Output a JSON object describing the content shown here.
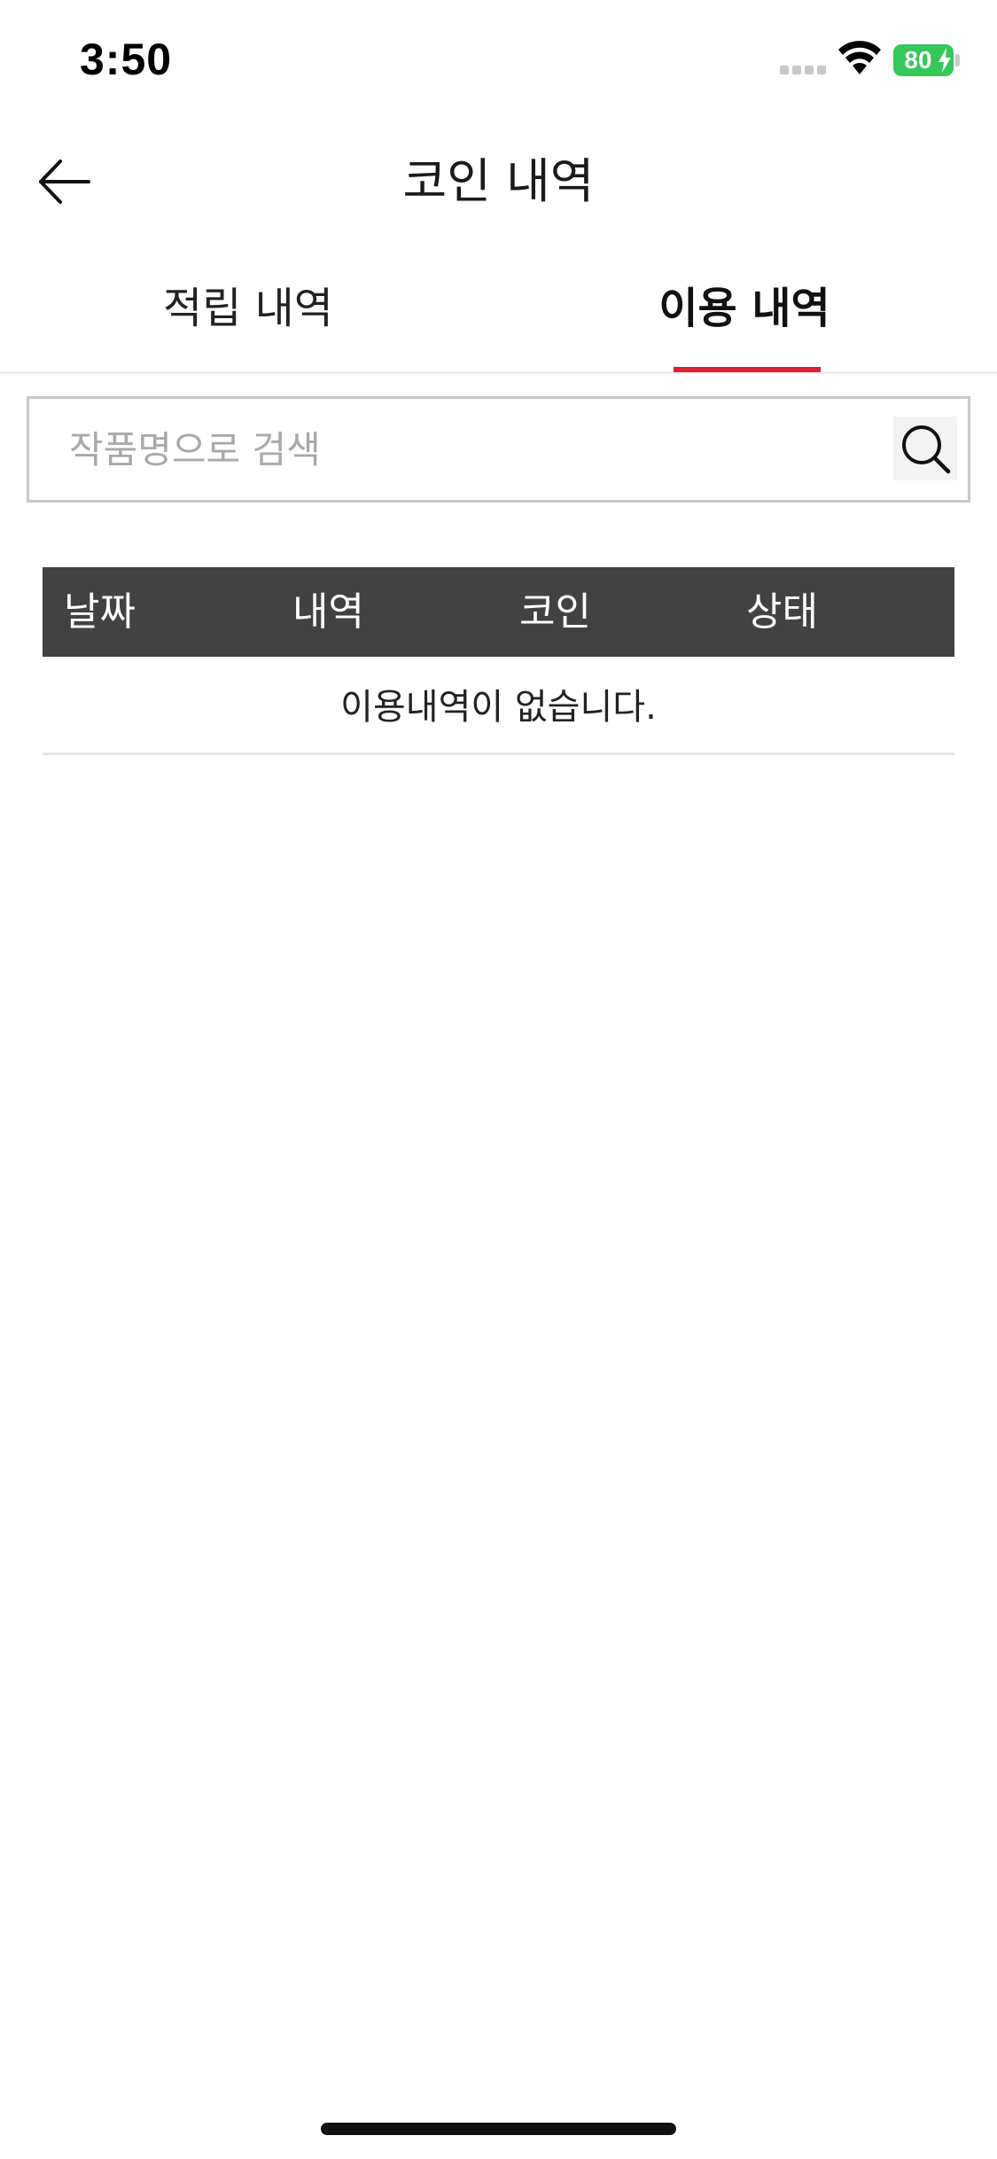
{
  "status_bar": {
    "time": "3:50",
    "battery_level": "80",
    "battery_color": "#34c759"
  },
  "header": {
    "title": "코인 내역",
    "back_icon": "arrow-left-icon"
  },
  "tabs": [
    {
      "label": "적립 내역",
      "active": false
    },
    {
      "label": "이용 내역",
      "active": true
    }
  ],
  "accent_color": "#e0202e",
  "search": {
    "placeholder": "작품명으로 검색",
    "value": "",
    "icon": "search-icon"
  },
  "table": {
    "columns": [
      "날짜",
      "내역",
      "코인",
      "상태"
    ],
    "empty_message": "이용내역이 없습니다.",
    "header_color": "#424242"
  }
}
